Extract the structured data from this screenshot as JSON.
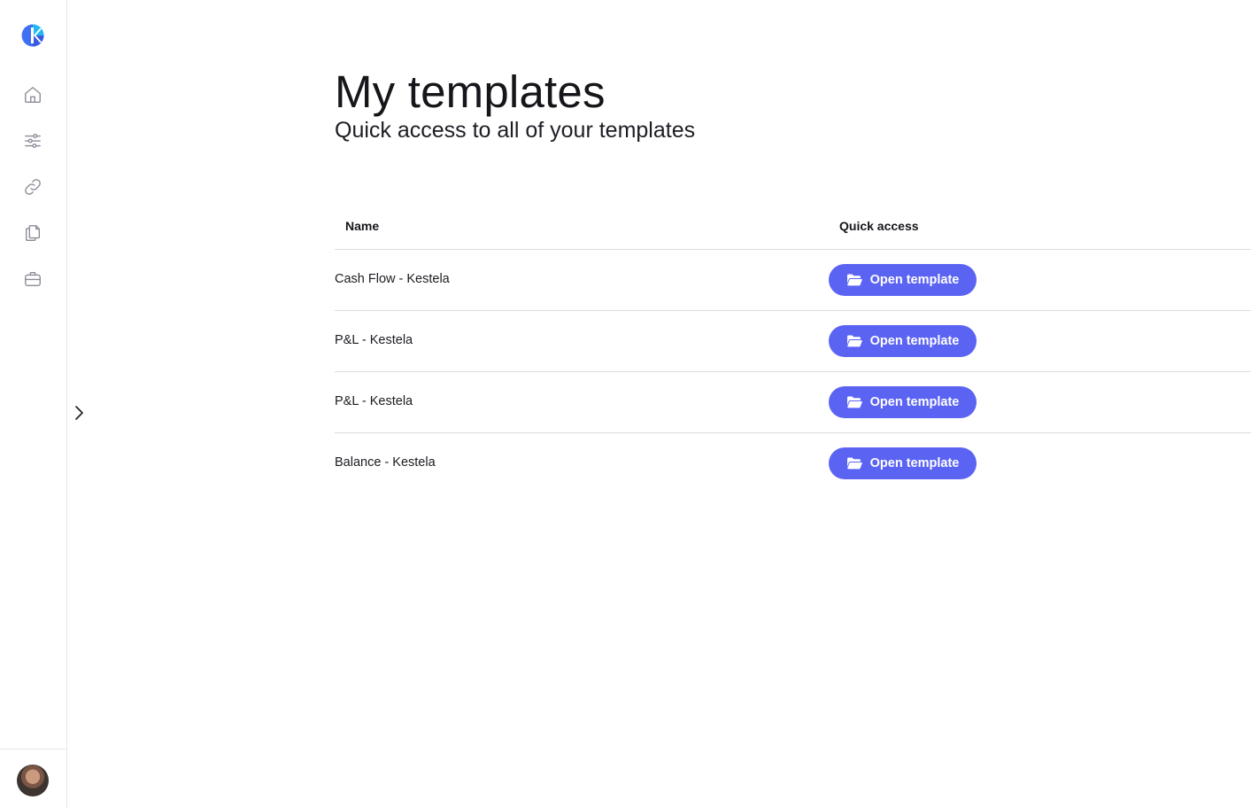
{
  "app": {
    "logo_icon": "kestela-logo-icon",
    "brand_colors": {
      "logo_blue": "#3f6ff2",
      "logo_cyan": "#22b8f0",
      "accent": "#5b63f3"
    }
  },
  "sidebar": {
    "items": [
      {
        "name": "home",
        "icon": "home-icon"
      },
      {
        "name": "settings",
        "icon": "sliders-icon"
      },
      {
        "name": "integrations",
        "icon": "link-icon"
      },
      {
        "name": "templates",
        "icon": "documents-icon"
      },
      {
        "name": "portfolio",
        "icon": "briefcase-icon"
      }
    ],
    "expand_icon": "chevron-right-icon",
    "avatar_icon": "user-avatar"
  },
  "header": {
    "title": "My templates",
    "subtitle": "Quick access to all of your templates"
  },
  "table": {
    "columns": {
      "name": "Name",
      "quick_access": "Quick access"
    },
    "rows": [
      {
        "name": "Cash Flow - Kestela",
        "action": "Open template"
      },
      {
        "name": "P&L - Kestela",
        "action": "Open template"
      },
      {
        "name": "P&L - Kestela",
        "action": "Open template"
      },
      {
        "name": "Balance - Kestela",
        "action": "Open template"
      }
    ]
  }
}
